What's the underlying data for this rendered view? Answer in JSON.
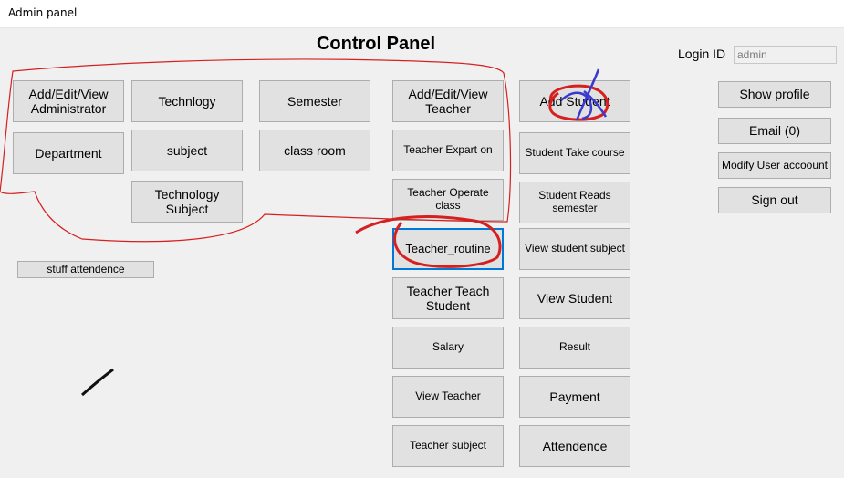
{
  "window": {
    "title": "Admin panel"
  },
  "header": {
    "title": "Control Panel"
  },
  "login": {
    "label": "Login ID",
    "value": "admin"
  },
  "buttons": {
    "add_admin": "Add/Edit/View\nAdministrator",
    "technology": "Technlogy",
    "semester": "Semester",
    "department": "Department",
    "subject": "subject",
    "class_room": "class room",
    "technology_subject": "Technology\nSubject",
    "stuff_attendence": "stuff attendence",
    "add_teacher": "Add/Edit/View\nTeacher",
    "teacher_expert_on": "Teacher Expart on",
    "teacher_operate_class": "Teacher Operate class",
    "teacher_routine": "Teacher_routine",
    "teacher_teach_student": "Teacher Teach\nStudent",
    "salary": "Salary",
    "view_teacher": "View Teacher",
    "teacher_subject": "Teacher subject",
    "add_student": "Add Student",
    "student_take_course": "Student Take course",
    "student_reads_semester": "Student Reads\nsemester",
    "view_student_subject": "View student subject",
    "view_student": "View Student",
    "result": "Result",
    "payment": "Payment",
    "attendence": "Attendence",
    "show_profile": "Show profile",
    "email": "Email  (0)",
    "modify_user_account": "Modify User accoount",
    "sign_out": "Sign out"
  },
  "annotations": {
    "red": "#d62020",
    "blue": "#3a3ad0",
    "black": "#111111"
  }
}
